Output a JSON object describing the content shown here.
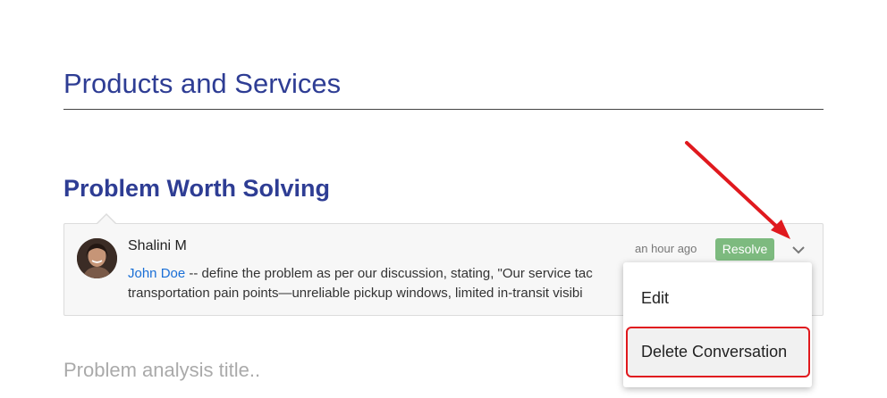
{
  "section": {
    "title": "Products and Services",
    "subtitle": "Problem Worth Solving",
    "next_placeholder": "Problem analysis title.."
  },
  "comment": {
    "author": "Shalini M",
    "timestamp": "an hour ago",
    "resolve_label": "Resolve",
    "mention": "John Doe",
    "body_line1": " -- define the problem as per our discussion, stating, \"Our service tac",
    "body_line2": "transportation pain points—unreliable pickup windows, limited in-transit visibi"
  },
  "menu": {
    "items": [
      {
        "label": "Edit"
      },
      {
        "label": "Delete Conversation"
      }
    ]
  },
  "colors": {
    "title": "#2e3d94",
    "resolve": "#7dba7f",
    "mention": "#1a6fd6",
    "annotation": "#e0191e"
  }
}
